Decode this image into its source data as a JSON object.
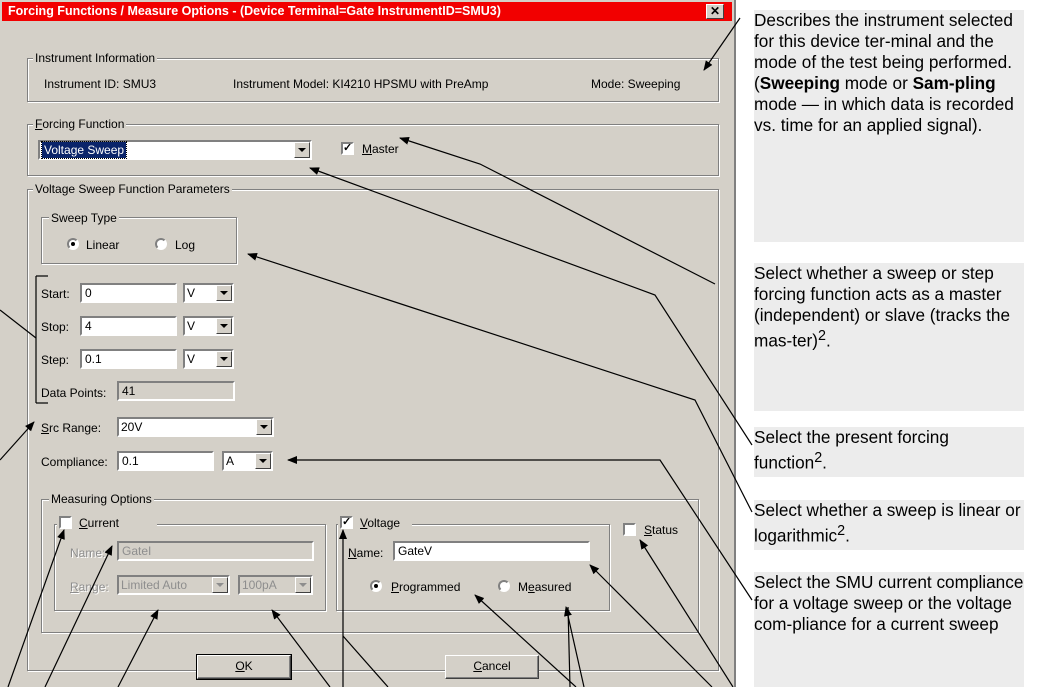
{
  "window": {
    "title": "Forcing Functions / Measure Options - (Device Terminal=Gate  InstrumentID=SMU3)",
    "close_glyph": "✕"
  },
  "instrument_info": {
    "caption": "Instrument Information",
    "id_text": "Instrument ID:  SMU3",
    "model_text": "Instrument Model:  KI4210 HPSMU with PreAmp",
    "mode_text": "Mode:  Sweeping"
  },
  "forcing": {
    "caption": "Forcing Function",
    "caption_mnemonic": "F",
    "caption_rest": "orcing Function",
    "selected": "Voltage Sweep",
    "master_checked": true,
    "master_mnemonic": "M",
    "master_rest": "aster"
  },
  "params": {
    "caption": "Voltage Sweep Function Parameters",
    "sweep_type": {
      "caption": "Sweep Type",
      "linear_label": "Linear",
      "log_label": "Log",
      "selected": "Linear"
    },
    "start": {
      "label": "Start:",
      "value": "0",
      "unit": "V"
    },
    "stop": {
      "label": "Stop:",
      "value": "4",
      "unit": "V"
    },
    "step": {
      "label": "Step:",
      "value": "0.1",
      "unit": "V"
    },
    "data_points": {
      "label": "Data Points:",
      "value": "41"
    },
    "src_range": {
      "label_mnemonic": "S",
      "label_rest": "rc Range:",
      "value": "20V"
    },
    "compliance": {
      "label": "Compliance:",
      "value": "0.1",
      "unit": "A"
    }
  },
  "measuring": {
    "caption": "Measuring Options",
    "current": {
      "checked": false,
      "label_mnemonic": "C",
      "label_rest": "urrent",
      "name_label": "Name:",
      "name_value": "GateI",
      "range_mnemonic": "R",
      "range_rest": "ange:",
      "range_value": "Limited Auto",
      "range_limit": "100pA"
    },
    "voltage": {
      "checked": true,
      "label_mnemonic": "V",
      "label_rest": "oltage",
      "name_mnemonic": "N",
      "name_rest": "ame:",
      "name_value": "GateV",
      "programmed_mnemonic": "P",
      "programmed_rest": "rogrammed",
      "measured_pre": "M",
      "measured_mnemonic": "e",
      "measured_rest": "asured",
      "selected": "Programmed"
    },
    "status": {
      "checked": false,
      "label_mnemonic": "S",
      "label_rest": "tatus"
    }
  },
  "buttons": {
    "ok_mnemonic": "O",
    "ok_rest": "K",
    "cancel_mnemonic": "C",
    "cancel_rest": "ancel"
  },
  "callouts": {
    "c1": {
      "text_a": "Describes the instrument selected for this device ter-minal and the mode of the test being performed. (",
      "bold_a": "Sweeping",
      "text_b": " mode or ",
      "bold_b": "Sam-pling",
      "text_c": " mode — in which data is recorded vs. time for an applied signal)."
    },
    "c2": {
      "text": " Select whether a sweep or step forcing function acts as a master (independent) or slave (tracks the mas-ter)",
      "sup": "2",
      "end": "."
    },
    "c3": {
      "text": "Select the present forcing function",
      "sup": "2",
      "end": "."
    },
    "c4": {
      "text": "Select whether a sweep is linear or logarithmic",
      "sup": "2",
      "end": "."
    },
    "c5": {
      "text": "Select the SMU current compliance for a voltage sweep or the voltage com-pliance for a current sweep"
    }
  },
  "colors": {
    "title_bar": "#f20000",
    "dialog_face": "#d4d0c8",
    "callout_bg": "#ececec"
  }
}
